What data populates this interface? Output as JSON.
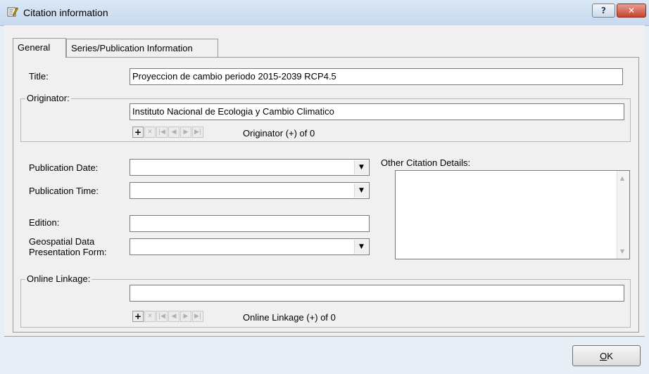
{
  "window": {
    "title": "Citation information",
    "help_icon": "question-mark",
    "close_icon": "x"
  },
  "tabs": [
    {
      "label": "General",
      "active": true
    },
    {
      "label": "Series/Publication Information",
      "active": false
    }
  ],
  "fields": {
    "title_label": "Title:",
    "title_value": "Proyeccion de cambio periodo 2015-2039 RCP4.5",
    "originator_group": "Originator:",
    "originator_value": "Instituto Nacional de Ecologia y Cambio Climatico",
    "originator_nav_text": "Originator (+) of 0",
    "pub_date_label": "Publication Date:",
    "pub_date_value": "",
    "pub_time_label": "Publication Time:",
    "pub_time_value": "",
    "edition_label": "Edition:",
    "edition_value": "",
    "geo_form_label_1": "Geospatial Data",
    "geo_form_label_2": "Presentation Form:",
    "geo_form_value": "",
    "other_details_label": "Other Citation Details:",
    "other_details_value": "",
    "online_group": "Online Linkage:",
    "online_value": "",
    "online_nav_text": "Online Linkage (+) of 0"
  },
  "nav_buttons": [
    "+",
    "×",
    "|◀",
    "◀",
    "▶",
    "▶|"
  ],
  "ok_button": {
    "label_underlined": "O",
    "label_rest": "K"
  }
}
